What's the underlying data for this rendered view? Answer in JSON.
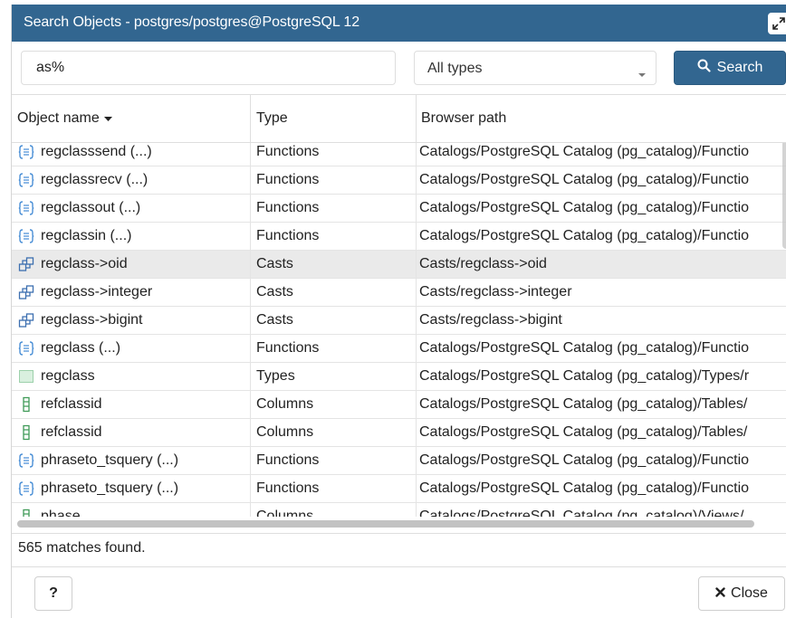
{
  "dialog": {
    "title": "Search Objects - postgres/postgres@PostgreSQL 12",
    "title_bg": "#326690"
  },
  "search": {
    "query": "as%",
    "type_value": "All types",
    "button_label": "Search",
    "button_bg": "#326690"
  },
  "columns": {
    "name": "Object name",
    "type": "Type",
    "path": "Browser path"
  },
  "rows": [
    {
      "icon": "function-icon",
      "name": "regclasssend (...)",
      "type": "Functions",
      "path": "Catalogs/PostgreSQL Catalog (pg_catalog)/Functio"
    },
    {
      "icon": "function-icon",
      "name": "regclassrecv (...)",
      "type": "Functions",
      "path": "Catalogs/PostgreSQL Catalog (pg_catalog)/Functio"
    },
    {
      "icon": "function-icon",
      "name": "regclassout (...)",
      "type": "Functions",
      "path": "Catalogs/PostgreSQL Catalog (pg_catalog)/Functio"
    },
    {
      "icon": "function-icon",
      "name": "regclassin (...)",
      "type": "Functions",
      "path": "Catalogs/PostgreSQL Catalog (pg_catalog)/Functio"
    },
    {
      "icon": "cast-icon",
      "name": "regclass->oid",
      "type": "Casts",
      "path": "Casts/regclass->oid",
      "selected": true
    },
    {
      "icon": "cast-icon",
      "name": "regclass->integer",
      "type": "Casts",
      "path": "Casts/regclass->integer"
    },
    {
      "icon": "cast-icon",
      "name": "regclass->bigint",
      "type": "Casts",
      "path": "Casts/regclass->bigint"
    },
    {
      "icon": "function-icon",
      "name": "regclass (...)",
      "type": "Functions",
      "path": "Catalogs/PostgreSQL Catalog (pg_catalog)/Functio"
    },
    {
      "icon": "type-icon",
      "name": "regclass",
      "type": "Types",
      "path": "Catalogs/PostgreSQL Catalog (pg_catalog)/Types/r"
    },
    {
      "icon": "column-icon",
      "name": "refclassid",
      "type": "Columns",
      "path": "Catalogs/PostgreSQL Catalog (pg_catalog)/Tables/"
    },
    {
      "icon": "column-icon",
      "name": "refclassid",
      "type": "Columns",
      "path": "Catalogs/PostgreSQL Catalog (pg_catalog)/Tables/"
    },
    {
      "icon": "function-icon",
      "name": "phraseto_tsquery (...)",
      "type": "Functions",
      "path": "Catalogs/PostgreSQL Catalog (pg_catalog)/Functio"
    },
    {
      "icon": "function-icon",
      "name": "phraseto_tsquery (...)",
      "type": "Functions",
      "path": "Catalogs/PostgreSQL Catalog (pg_catalog)/Functio"
    },
    {
      "icon": "column-icon",
      "name": "phase",
      "type": "Columns",
      "path": "Catalogs/PostgreSQL Catalog (pg_catalog)/Views/."
    }
  ],
  "status": "565 matches found.",
  "footer": {
    "help_label": "?",
    "close_label": "Close"
  }
}
